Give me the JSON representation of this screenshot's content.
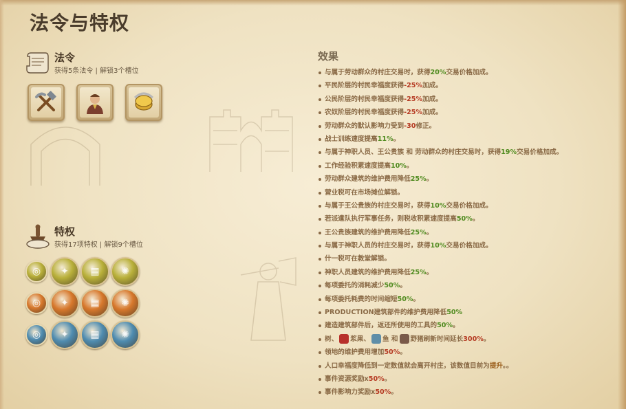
{
  "title": "法令与特权",
  "edicts": {
    "title": "法令",
    "subtitle": "获得5条法令 | 解锁3个槽位",
    "cards": [
      {
        "icon": "hammer-pickaxe-icon"
      },
      {
        "icon": "portrait-icon"
      },
      {
        "icon": "gold-coins-icon"
      }
    ]
  },
  "privileges": {
    "title": "特权",
    "subtitle": "获得17项特权 | 解锁9个槽位",
    "rows": [
      {
        "tier": "yellow",
        "color": "#b9b03a",
        "icons": [
          "yellow-tier-icon",
          "yellow-privilege-icon",
          "yellow-crate-icon",
          "yellow-eye-icon"
        ]
      },
      {
        "tier": "orange",
        "color": "#d7782c",
        "icons": [
          "orange-tier-icon",
          "orange-crate-icon",
          "orange-flame-icon",
          "orange-scroll-icon"
        ]
      },
      {
        "tier": "blue",
        "color": "#4f8cb0",
        "icons": [
          "blue-tier-icon",
          "blue-tool-icon",
          "blue-crate-icon",
          "blue-horn-icon"
        ]
      }
    ]
  },
  "effects": {
    "title": "效果",
    "items": [
      {
        "segments": [
          {
            "t": "与属于劳动群众的村庄交易时，获得"
          },
          {
            "t": "20%",
            "c": "g"
          },
          {
            "t": "交易价格加成。"
          }
        ]
      },
      {
        "segments": [
          {
            "t": "平民阶层的村民幸福度获得"
          },
          {
            "t": "-25%",
            "c": "r"
          },
          {
            "t": "加成。"
          }
        ]
      },
      {
        "segments": [
          {
            "t": "公民阶层的村民幸福度获得"
          },
          {
            "t": "-25%",
            "c": "r"
          },
          {
            "t": "加成。"
          }
        ]
      },
      {
        "segments": [
          {
            "t": "农奴阶层的村民幸福度获得"
          },
          {
            "t": "-25%",
            "c": "r"
          },
          {
            "t": "加成。"
          }
        ]
      },
      {
        "segments": [
          {
            "t": "劳动群众的默认影响力受到"
          },
          {
            "t": "-30",
            "c": "r"
          },
          {
            "t": "修正。"
          }
        ]
      },
      {
        "segments": [
          {
            "t": "战士训练速度提高"
          },
          {
            "t": "11%",
            "c": "g"
          },
          {
            "t": "。"
          }
        ]
      },
      {
        "segments": [
          {
            "t": "与属于神职人员、王公贵族 和 劳动群众的村庄交易时，获得"
          },
          {
            "t": "19%",
            "c": "g"
          },
          {
            "t": "交易价格加成。"
          }
        ]
      },
      {
        "segments": [
          {
            "t": "工作经验积累速度提高"
          },
          {
            "t": "10%",
            "c": "g"
          },
          {
            "t": "。"
          }
        ]
      },
      {
        "segments": [
          {
            "t": "劳动群众建筑的维护费用降低"
          },
          {
            "t": "25%",
            "c": "g"
          },
          {
            "t": "。"
          }
        ]
      },
      {
        "segments": [
          {
            "t": "营业税可在市场摊位解锁。"
          }
        ]
      },
      {
        "segments": [
          {
            "t": "与属于王公贵族的村庄交易时，获得"
          },
          {
            "t": "10%",
            "c": "g"
          },
          {
            "t": "交易价格加成。"
          }
        ]
      },
      {
        "segments": [
          {
            "t": "若派遣队执行军事任务，则税收积累速度提高"
          },
          {
            "t": "50%",
            "c": "g"
          },
          {
            "t": "。"
          }
        ]
      },
      {
        "segments": [
          {
            "t": "王公贵族建筑的维护费用降低"
          },
          {
            "t": "25%",
            "c": "g"
          },
          {
            "t": "。"
          }
        ]
      },
      {
        "segments": [
          {
            "t": "与属于神职人员的村庄交易时，获得"
          },
          {
            "t": "10%",
            "c": "g"
          },
          {
            "t": "交易价格加成。"
          }
        ]
      },
      {
        "segments": [
          {
            "t": "什一税可在教堂解锁。"
          }
        ]
      },
      {
        "segments": [
          {
            "t": "神职人员建筑的维护费用降低"
          },
          {
            "t": "25%",
            "c": "g"
          },
          {
            "t": "。"
          }
        ]
      },
      {
        "segments": [
          {
            "t": "每项委托的消耗减少"
          },
          {
            "t": "50%",
            "c": "g"
          },
          {
            "t": "。"
          }
        ]
      },
      {
        "segments": [
          {
            "t": "每项委托耗费的时间缩短"
          },
          {
            "t": "50%",
            "c": "g"
          },
          {
            "t": "。"
          }
        ]
      },
      {
        "segments": [
          {
            "t": "PRODUCTION建筑部件的维护费用降低"
          },
          {
            "t": "50%",
            "c": "g"
          }
        ]
      },
      {
        "segments": [
          {
            "t": "建造建筑部件后，返还所使用的工具的"
          },
          {
            "t": "50%",
            "c": "g"
          },
          {
            "t": "。"
          }
        ]
      },
      {
        "segments": [
          {
            "t": "树、"
          },
          {
            "icon": "berries-icon",
            "color": "#b8302a"
          },
          {
            "t": "浆果、"
          },
          {
            "icon": "fish-icon",
            "color": "#5f8ea8"
          },
          {
            "t": "鱼 和"
          },
          {
            "icon": "boar-icon",
            "color": "#7a5a4a"
          },
          {
            "t": "野猪刷新时间延长"
          },
          {
            "t": "300%",
            "c": "r"
          },
          {
            "t": "。"
          }
        ]
      },
      {
        "segments": [
          {
            "t": "领地的维护费用增加"
          },
          {
            "t": "50%",
            "c": "r"
          },
          {
            "t": "。"
          }
        ]
      },
      {
        "segments": [
          {
            "t": "人口幸福度降低到一定数值就会离开村庄，该数值目前为"
          },
          {
            "t": "提升",
            "c": "em"
          },
          {
            "t": "。。"
          }
        ]
      },
      {
        "segments": [
          {
            "t": "事件资源奖励x"
          },
          {
            "t": "50%",
            "c": "r"
          },
          {
            "t": "。"
          }
        ]
      },
      {
        "segments": [
          {
            "t": "事件影响力奖励x"
          },
          {
            "t": "50%",
            "c": "r"
          },
          {
            "t": "。"
          }
        ]
      }
    ]
  }
}
